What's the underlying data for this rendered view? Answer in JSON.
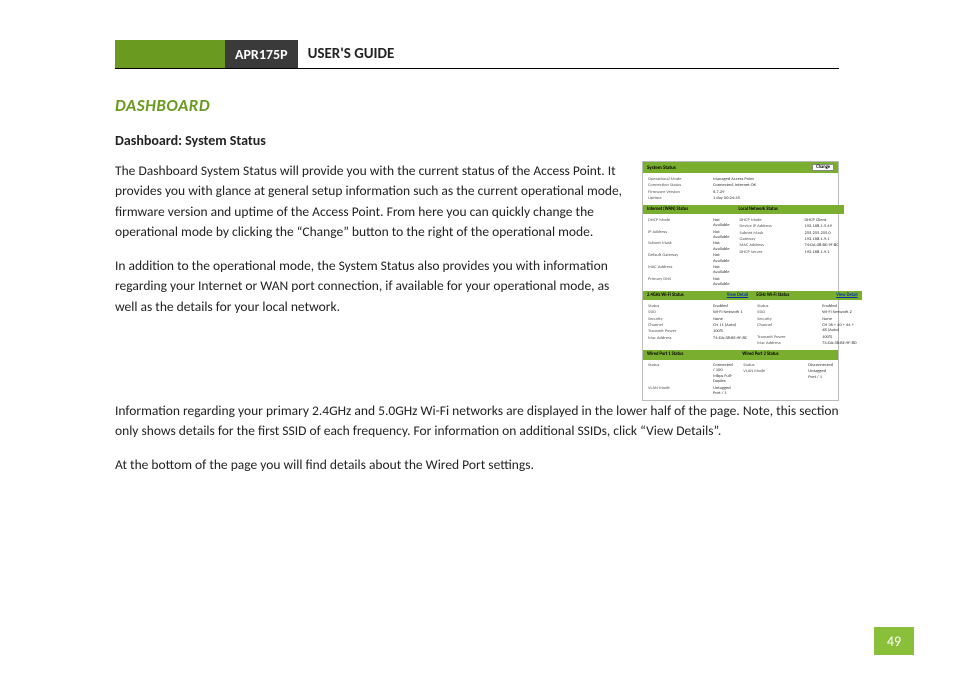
{
  "header": {
    "model": "APR175P",
    "title": "USER'S GUIDE"
  },
  "section_heading": "DASHBOARD",
  "sub_heading": "Dashboard: System Status",
  "paragraphs": {
    "p1": "The Dashboard System Status will provide you with the current status of the Access Point.  It provides you with glance at general setup information such as the current operational mode, firmware version and uptime of the Access Point.  From here you can quickly change the operational mode by clicking the “Change” button to the right of the operational mode.",
    "p2": "In addition to the operational mode, the System Status also provides you with information regarding your Internet or WAN port connection, if available for your operational mode, as well as the details for your local network.",
    "p3": "Information regarding your primary 2.4GHz and 5.0GHz Wi-Fi networks are displayed in the lower half of the page.  Note, this section only shows details for the first SSID of each frequency.  For information on additional SSIDs, click “View Details”.",
    "p4": "At the bottom of the page you will find details about the Wired Port settings."
  },
  "screenshot": {
    "system_status": {
      "title": "System Status",
      "change_btn": "Change",
      "rows": [
        {
          "k": "Operational Mode",
          "v": "Managed Access Point"
        },
        {
          "k": "Connection Status",
          "v": "Connected, Internet OK"
        },
        {
          "k": "Firmware Version",
          "v": "6.7.29"
        },
        {
          "k": "Uptime",
          "v": "1 day 00:24:45"
        }
      ]
    },
    "internet": {
      "title": "Internet (WAN) Status",
      "rows": [
        {
          "k": "DHCP Mode",
          "v": "Not Available"
        },
        {
          "k": "IP Address",
          "v": "Not Available"
        },
        {
          "k": "Subnet Mask",
          "v": "Not Available"
        },
        {
          "k": "Default Gateway",
          "v": "Not Available"
        },
        {
          "k": "MAC Address",
          "v": "Not Available"
        },
        {
          "k": "Primary DNS",
          "v": "Not Available"
        }
      ]
    },
    "local": {
      "title": "Local Network Status",
      "rows": [
        {
          "k": "DHCP Mode",
          "v": "DHCP Client"
        },
        {
          "k": "Device IP Address",
          "v": "192.168.1.5.49"
        },
        {
          "k": "Subnet Mask",
          "v": "255.255.255.0"
        },
        {
          "k": "Gateway",
          "v": "192.168.1.9.1"
        },
        {
          "k": "MAC Address",
          "v": "74:DA:38:BE:9F:8C"
        },
        {
          "k": "DHCP Server",
          "v": "192.168.1.9.1"
        }
      ]
    },
    "wifi24": {
      "title": "2.4GHz Wi-Fi Status",
      "link": "View Detail",
      "rows": [
        {
          "k": "Status",
          "v": "Enabled"
        },
        {
          "k": "SSID",
          "v": "Wi-Fi Network 1"
        },
        {
          "k": "Security",
          "v": "None"
        },
        {
          "k": "Channel",
          "v": "CH 11 (Auto)"
        },
        {
          "k": "Transmit Power",
          "v": "100%"
        },
        {
          "k": "Mac Address",
          "v": "74:DA:38:BE:9F:8C"
        }
      ]
    },
    "wifi5": {
      "title": "5GHz Wi-Fi Status",
      "link": "View Detail",
      "rows": [
        {
          "k": "Status",
          "v": "Enabled"
        },
        {
          "k": "SSID",
          "v": "Wi-Fi Network 2"
        },
        {
          "k": "Security",
          "v": "None"
        },
        {
          "k": "Channel",
          "v": "CH 36 + 40 + 44 + 48 (Auto)"
        },
        {
          "k": "Transmit Power",
          "v": "100%"
        },
        {
          "k": "Mac Address",
          "v": "74:DA:38:BE:9F:8D"
        }
      ]
    },
    "port1": {
      "title": "Wired Port 1 Status",
      "rows": [
        {
          "k": "Status",
          "v": "Connected / 100 Mbps Full-Duplex"
        },
        {
          "k": "VLAN Mode",
          "v": "Untagged Port / 1"
        }
      ]
    },
    "port2": {
      "title": "Wired Port 2 Status",
      "rows": [
        {
          "k": "Status",
          "v": "Disconnected"
        },
        {
          "k": "VLAN Mode",
          "v": "Untagged Port / 1"
        }
      ]
    }
  },
  "page_number": "49"
}
